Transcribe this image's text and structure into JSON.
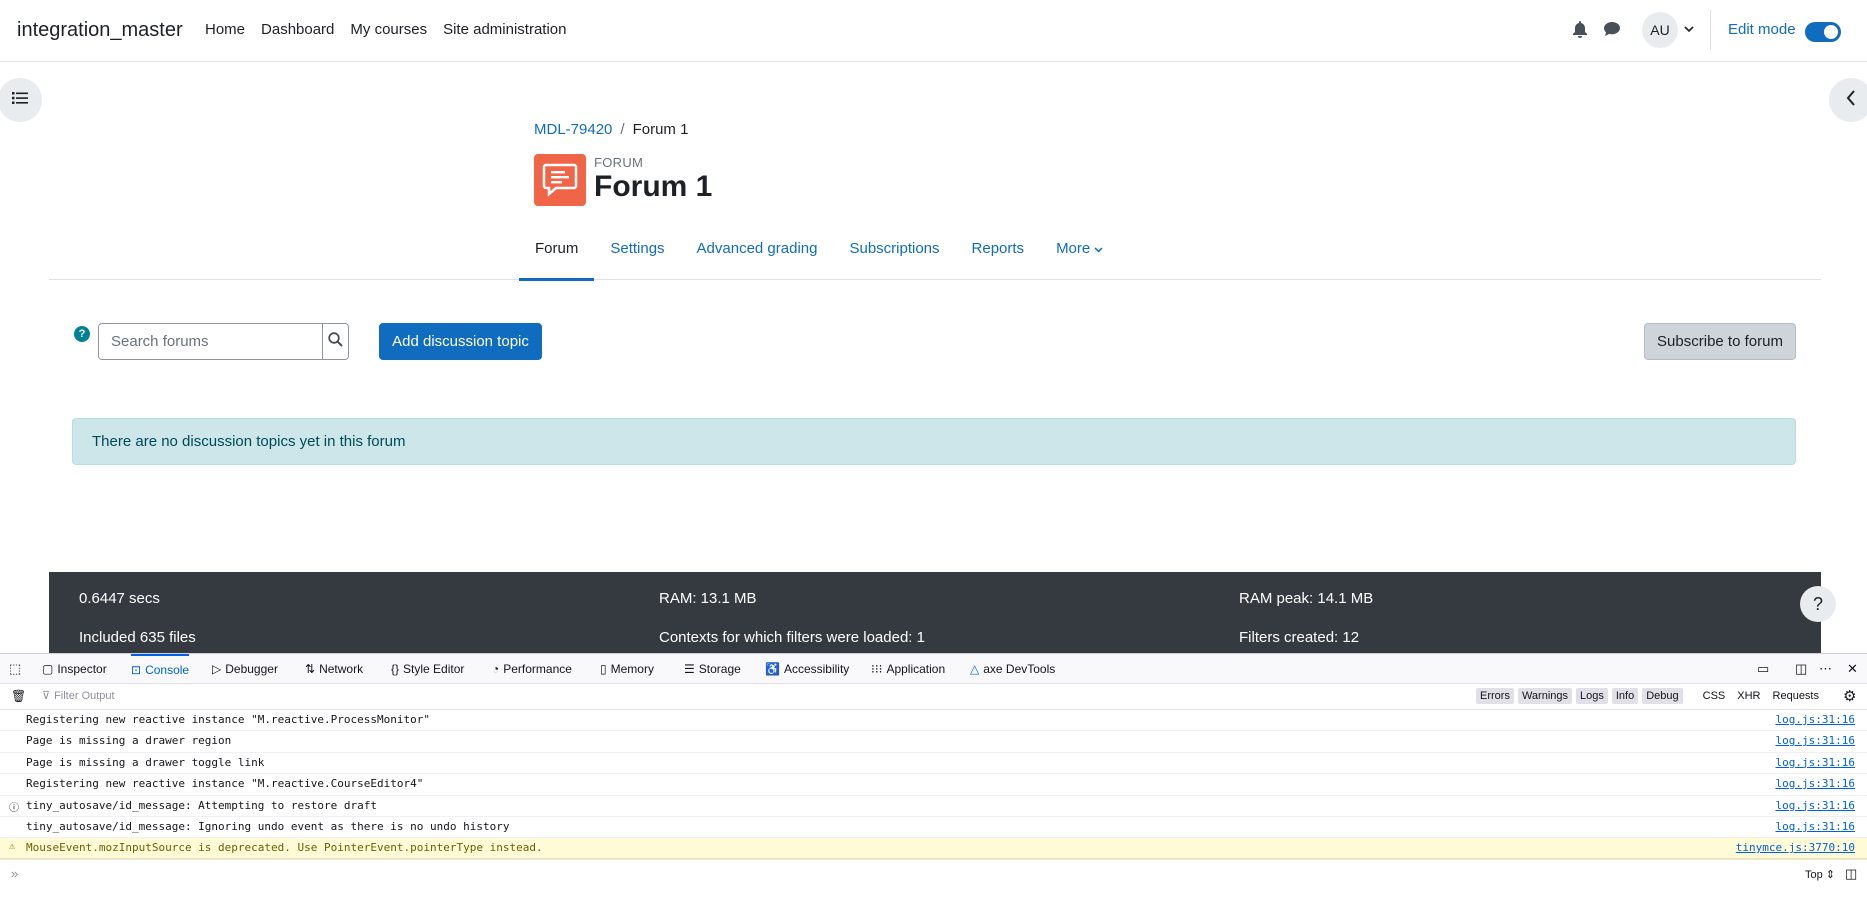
{
  "navbar": {
    "brand": "integration_master",
    "links": [
      "Home",
      "Dashboard",
      "My courses",
      "Site administration"
    ],
    "avatar_initials": "AU",
    "edit_mode_label": "Edit mode",
    "edit_mode_on": true
  },
  "breadcrumb": {
    "course": "MDL-79420",
    "separator": "/",
    "current": "Forum 1"
  },
  "header": {
    "kind": "FORUM",
    "title": "Forum 1",
    "icon_color": "#f06448"
  },
  "secondary_nav": {
    "tabs": [
      "Forum",
      "Settings",
      "Advanced grading",
      "Subscriptions",
      "Reports",
      "More"
    ],
    "active": "Forum"
  },
  "forum": {
    "search_placeholder": "Search forums",
    "add_button": "Add discussion topic",
    "subscribe_button": "Subscribe to forum",
    "empty_notice": "There are no discussion topics yet in this forum"
  },
  "footer": {
    "time": "0.6447 secs",
    "ram": "RAM: 13.1 MB",
    "ram_peak": "RAM peak: 14.1 MB",
    "files": "Included 635 files",
    "contexts": "Contexts for which filters were loaded: 1",
    "filters": "Filters created: 12"
  },
  "devtools": {
    "tabs": [
      "Inspector",
      "Console",
      "Debugger",
      "Network",
      "Style Editor",
      "Performance",
      "Memory",
      "Storage",
      "Accessibility",
      "Application",
      "axe DevTools"
    ],
    "active_tab": "Console",
    "filter_placeholder": "Filter Output",
    "filter_buttons": [
      "Errors",
      "Warnings",
      "Logs",
      "Info",
      "Debug"
    ],
    "extra_filters": [
      "CSS",
      "XHR",
      "Requests"
    ],
    "logs": [
      {
        "msg": "Registering new reactive instance \"M.reactive.ProcessMonitor\"",
        "src": "log.js:31:16",
        "level": "log"
      },
      {
        "msg": "Page is missing a drawer region",
        "src": "log.js:31:16",
        "level": "log"
      },
      {
        "msg": "Page is missing a drawer toggle link",
        "src": "log.js:31:16",
        "level": "log"
      },
      {
        "msg": "Registering new reactive instance \"M.reactive.CourseEditor4\"",
        "src": "log.js:31:16",
        "level": "log"
      },
      {
        "msg": "tiny_autosave/id_message: Attempting to restore draft",
        "src": "log.js:31:16",
        "level": "info"
      },
      {
        "msg": "tiny_autosave/id_message: Ignoring undo event as there is no undo history",
        "src": "log.js:31:16",
        "level": "log"
      },
      {
        "msg": "MouseEvent.mozInputSource is deprecated. Use PointerEvent.pointerType instead.",
        "src": "tinymce.js:3770:10",
        "level": "warn"
      }
    ],
    "context": "Top"
  },
  "colors": {
    "primary": "#0f6cbf",
    "footer_bg": "#343a40",
    "alert_bg": "#cce6ea"
  }
}
